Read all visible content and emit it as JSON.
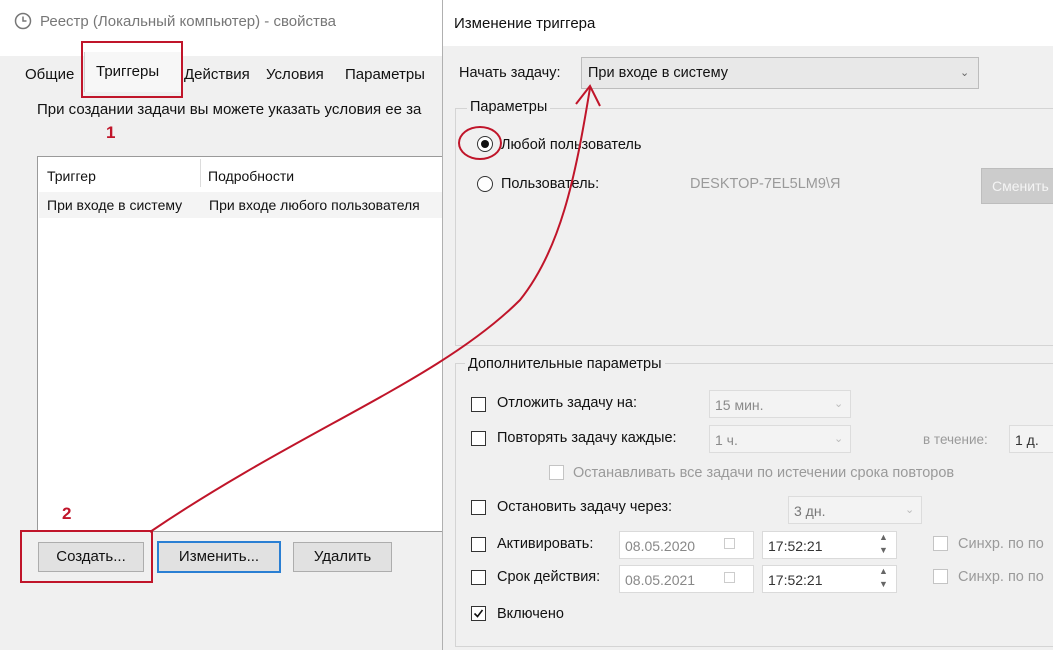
{
  "left_window": {
    "title": "Реестр (Локальный компьютер) - свойства",
    "tabs": [
      "Общие",
      "Триггеры",
      "Действия",
      "Условия",
      "Параметры"
    ],
    "intro_text": "При создании задачи вы можете указать условия ее за",
    "table": {
      "headers": [
        "Триггер",
        "Подробности"
      ],
      "rows": [
        [
          "При входе в систему",
          "При входе любого пользователя"
        ]
      ]
    },
    "buttons": {
      "create": "Создать...",
      "edit": "Изменить...",
      "delete": "Удалить"
    }
  },
  "annotations": {
    "label_1": "1",
    "label_2": "2",
    "color": "#c0152a"
  },
  "dialog": {
    "title": "Изменение триггера",
    "start_task_label": "Начать задачу:",
    "start_task_value": "При входе в систему",
    "params_group": "Параметры",
    "any_user_label": "Любой пользователь",
    "user_label": "Пользователь:",
    "user_value": "DESKTOP-7EL5LM9\\Я",
    "change_button": "Сменить",
    "advanced_group": "Дополнительные параметры",
    "delay_label": "Отложить задачу на:",
    "delay_value": "15 мин.",
    "repeat_label": "Повторять задачу каждые:",
    "repeat_value": "1 ч.",
    "during_label": "в течение:",
    "during_value": "1 д.",
    "stop_all_label": "Останавливать все задачи по истечении срока повторов",
    "stop_after_label": "Остановить задачу через:",
    "stop_after_value": "3 дн.",
    "activate_label": "Активировать:",
    "activate_date": "08.05.2020",
    "activate_time": "17:52:21",
    "expire_label": "Срок действия:",
    "expire_date": "08.05.2021",
    "expire_time": "17:52:21",
    "sync_label": "Синхр. по по",
    "enabled_label": "Включено"
  }
}
